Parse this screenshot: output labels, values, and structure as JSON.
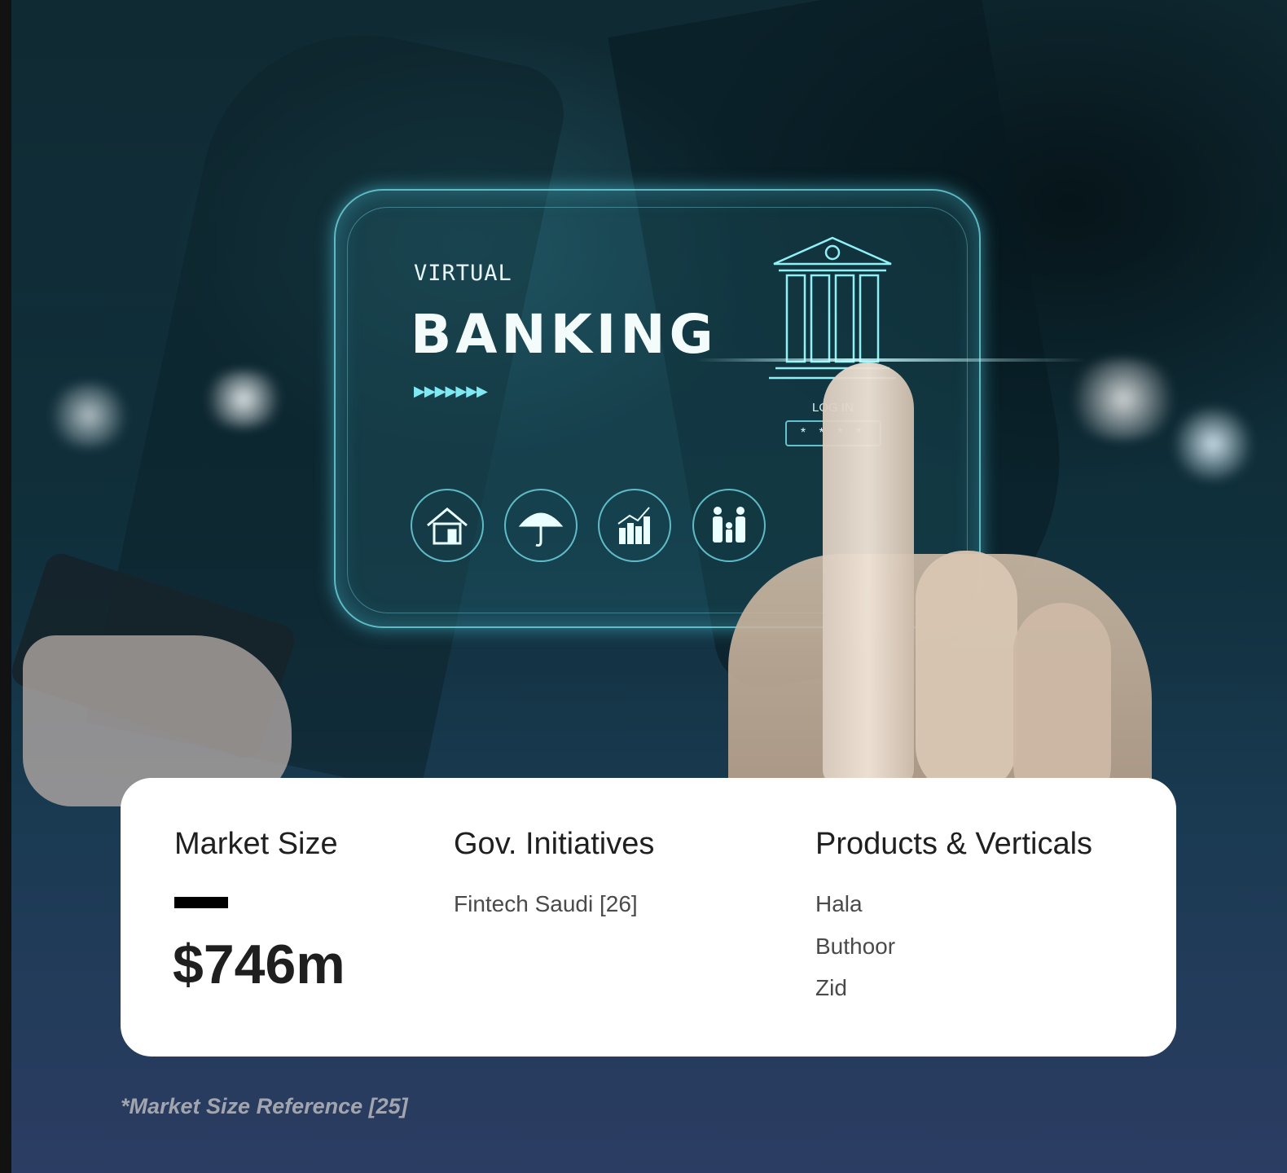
{
  "hero_card": {
    "virtual_label": "VIRTUAL",
    "banking_label": "BANKING",
    "arrows": "▶▶▶▶▶▶▶",
    "login_label": "LOG IN",
    "password_mask": "* * * *",
    "icons": [
      "home-icon",
      "umbrella-icon",
      "growth-chart-icon",
      "family-icon",
      "bank-icon"
    ]
  },
  "panel": {
    "market_size": {
      "title": "Market Size",
      "value": "$746m"
    },
    "gov_initiatives": {
      "title": "Gov. Initiatives",
      "items": [
        "Fintech Saudi [26]"
      ]
    },
    "products": {
      "title": "Products & Verticals",
      "items": [
        "Hala",
        "Buthoor",
        "Zid"
      ]
    }
  },
  "footnote": "*Market Size Reference [25]",
  "colors": {
    "panel": "#ffffff",
    "text_dark": "#1f1f1f",
    "glow": "#7fe9f2",
    "footnote": "#a2a5ad"
  }
}
